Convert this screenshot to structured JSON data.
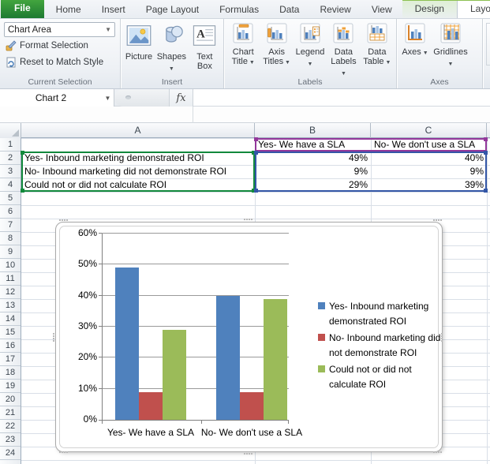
{
  "ribbon": {
    "tabs": [
      {
        "label": "File",
        "kind": "file"
      },
      {
        "label": "Home"
      },
      {
        "label": "Insert"
      },
      {
        "label": "Page Layout"
      },
      {
        "label": "Formulas"
      },
      {
        "label": "Data"
      },
      {
        "label": "Review"
      },
      {
        "label": "View"
      },
      {
        "label": "Design",
        "kind": "contextual"
      },
      {
        "label": "Layout",
        "kind": "contextual",
        "active": true
      }
    ],
    "current_selection": {
      "label": "Current Selection",
      "combo_value": "Chart Area",
      "buttons": [
        "Format Selection",
        "Reset to Match Style"
      ]
    },
    "insert": {
      "label": "Insert",
      "buttons": [
        {
          "label": "Picture",
          "icon": "picture-icon",
          "arrow": false
        },
        {
          "label": "Shapes",
          "icon": "shapes-icon",
          "arrow": true
        },
        {
          "label": "Text Box",
          "icon": "text-box-icon",
          "arrow": false
        }
      ]
    },
    "labels": {
      "label": "Labels",
      "buttons": [
        {
          "label": "Chart Title",
          "icon": "chart-title-icon",
          "arrow": true
        },
        {
          "label": "Axis Titles",
          "icon": "axis-titles-icon",
          "arrow": true
        },
        {
          "label": "Legend",
          "icon": "legend-icon",
          "arrow": true
        },
        {
          "label": "Data Labels",
          "icon": "data-labels-icon",
          "arrow": true
        },
        {
          "label": "Data Table",
          "icon": "data-table-icon",
          "arrow": true
        }
      ]
    },
    "axes": {
      "label": "Axes",
      "buttons": [
        {
          "label": "Axes",
          "icon": "axes-icon",
          "arrow": true
        },
        {
          "label": "Gridlines",
          "icon": "gridlines-icon",
          "arrow": true
        }
      ]
    }
  },
  "formula_bar": {
    "name_box": "Chart 2",
    "fx_label": "fx",
    "formula_value": ""
  },
  "sheet": {
    "column_headers": [
      "A",
      "B",
      "C"
    ],
    "visible_row_count": 24,
    "table": {
      "series_headers": [
        "Yes- We have a SLA",
        "No- We don't use a SLA"
      ],
      "row_labels": [
        "Yes- Inbound marketing demonstrated ROI",
        "No- Inbound marketing did not demonstrate ROI",
        "Could not or did not calculate ROI"
      ],
      "values": [
        [
          "49%",
          "40%"
        ],
        [
          "9%",
          "9%"
        ],
        [
          "29%",
          "39%"
        ]
      ]
    },
    "selection_colors": {
      "names_range": "#93389b",
      "labels_range": "#12893c",
      "values_range": "#3457a7"
    }
  },
  "chart_data": {
    "type": "bar",
    "title": "",
    "categories": [
      "Yes- We have a SLA",
      "No- We don't use a SLA"
    ],
    "series": [
      {
        "name": "Yes- Inbound marketing demonstrated ROI",
        "color": "#4F81BD",
        "values": [
          49,
          40
        ]
      },
      {
        "name": "No- Inbound marketing did not demonstrate ROI",
        "color": "#C0504D",
        "values": [
          9,
          9
        ]
      },
      {
        "name": "Could not or did not calculate ROI",
        "color": "#9BBB59",
        "values": [
          29,
          39
        ]
      }
    ],
    "ylim": [
      0,
      60
    ],
    "ytick_step": 10,
    "ytick_labels": [
      "0%",
      "10%",
      "20%",
      "30%",
      "40%",
      "50%",
      "60%"
    ],
    "grid": true,
    "legend_position": "right"
  }
}
